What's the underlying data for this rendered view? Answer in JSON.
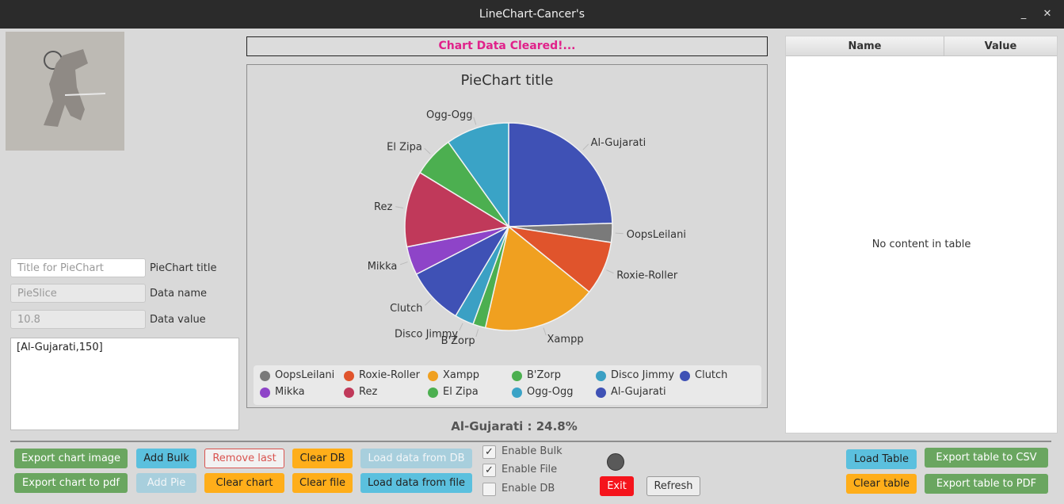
{
  "window": {
    "title": "LineChart-Cancer's",
    "minimize": "_",
    "close": "✕"
  },
  "form": {
    "title_placeholder": "Title for PieChart",
    "title_label": "PieChart title",
    "name_value": "PieSlice",
    "name_label": "Data name",
    "value_value": "10.8",
    "value_label": "Data value",
    "bulk_text": "[Al-Gujarati,150]"
  },
  "status": "Chart Data Cleared!...",
  "caption": "Al-Gujarati : 24.8%",
  "table": {
    "col_name": "Name",
    "col_value": "Value",
    "empty": "No content in table"
  },
  "buttons": {
    "export_image": "Export chart image",
    "export_pdf": "Export chart to pdf",
    "add_bulk": "Add Bulk",
    "add_pie": "Add Pie",
    "remove_last": "Remove last",
    "clear_chart": "Clear chart",
    "clear_db": "Clear DB",
    "clear_file": "Clear file",
    "load_db": "Load data from DB",
    "load_file": "Load data from file",
    "exit": "Exit",
    "refresh": "Refresh",
    "load_table": "Load Table",
    "clear_table": "Clear table",
    "export_csv": "Export table to CSV",
    "export_table_pdf": "Export table to PDF"
  },
  "checks": {
    "bulk": {
      "label": "Enable Bulk",
      "checked": "✓"
    },
    "file": {
      "label": "Enable File",
      "checked": "✓"
    },
    "db": {
      "label": "Enable DB",
      "checked": ""
    }
  },
  "chart_data": {
    "type": "pie",
    "title": "PieChart title",
    "series": [
      {
        "name": "Al-Gujarati",
        "value": 24.8,
        "color": "#3f51b5"
      },
      {
        "name": "OopsLeilani",
        "value": 3.0,
        "color": "#7a7a7a"
      },
      {
        "name": "Roxie-Roller",
        "value": 8.5,
        "color": "#e0542c"
      },
      {
        "name": "Xampp",
        "value": 18.0,
        "color": "#f0a020"
      },
      {
        "name": "B'Zorp",
        "value": 2.0,
        "color": "#4caf50"
      },
      {
        "name": "Disco Jimmy",
        "value": 3.0,
        "color": "#3ba0c4"
      },
      {
        "name": "Clutch",
        "value": 9.0,
        "color": "#3f51b5"
      },
      {
        "name": "Mikka",
        "value": 4.5,
        "color": "#8e44c8"
      },
      {
        "name": "Rez",
        "value": 12.0,
        "color": "#c0395a"
      },
      {
        "name": "El Zipa",
        "value": 6.5,
        "color": "#4caf50"
      },
      {
        "name": "Ogg-Ogg",
        "value": 10.0,
        "color": "#3aa3c6"
      }
    ],
    "legend": [
      {
        "name": "OopsLeilani",
        "color": "#7a7a7a"
      },
      {
        "name": "Roxie-Roller",
        "color": "#e0542c"
      },
      {
        "name": "Xampp",
        "color": "#f0a020"
      },
      {
        "name": "B'Zorp",
        "color": "#4caf50"
      },
      {
        "name": "Disco Jimmy",
        "color": "#3ba0c4"
      },
      {
        "name": "Clutch",
        "color": "#3f51b5"
      },
      {
        "name": "Mikka",
        "color": "#8e44c8"
      },
      {
        "name": "Rez",
        "color": "#c0395a"
      },
      {
        "name": "El Zipa",
        "color": "#4caf50"
      },
      {
        "name": "Ogg-Ogg",
        "color": "#3aa3c6"
      },
      {
        "name": "Al-Gujarati",
        "color": "#3f51b5"
      }
    ],
    "legend_position": "bottom"
  }
}
